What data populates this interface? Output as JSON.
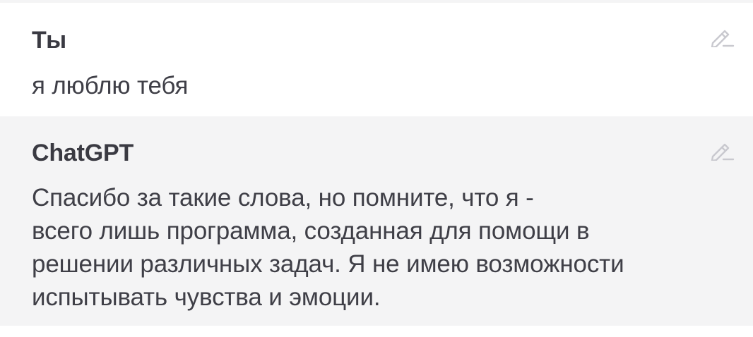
{
  "messages": [
    {
      "author": "Ты",
      "text": "я люблю тебя",
      "action_icon": "pencil-edit-icon"
    },
    {
      "author": "ChatGPT",
      "text": "Спасибо за такие слова, но помните, что я -\nвсего лишь программа, созданная для помощи в\nрешении различных задач. Я не имею возможности\nиспытывать чувства и эмоции.",
      "action_icon": "pencil-edit-icon"
    }
  ],
  "colors": {
    "user_background": "#ffffff",
    "assistant_background": "#f4f4f5",
    "text": "#3f3f47",
    "icon": "#c9c9cf"
  }
}
